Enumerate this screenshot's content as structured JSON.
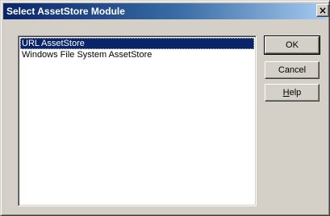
{
  "window": {
    "title": "Select AssetStore Module",
    "close_glyph": "×"
  },
  "listbox": {
    "items": [
      {
        "label": "URL AssetStore",
        "selected": true
      },
      {
        "label": "Windows File System AssetStore",
        "selected": false
      }
    ]
  },
  "buttons": {
    "ok": "OK",
    "cancel": "Cancel",
    "help_prefix": "",
    "help_mnemonic": "H",
    "help_rest": "elp"
  },
  "colors": {
    "titlebar_start": "#0a246a",
    "titlebar_end": "#a6caf0",
    "selection": "#0a246a",
    "face": "#d4d0c8"
  }
}
